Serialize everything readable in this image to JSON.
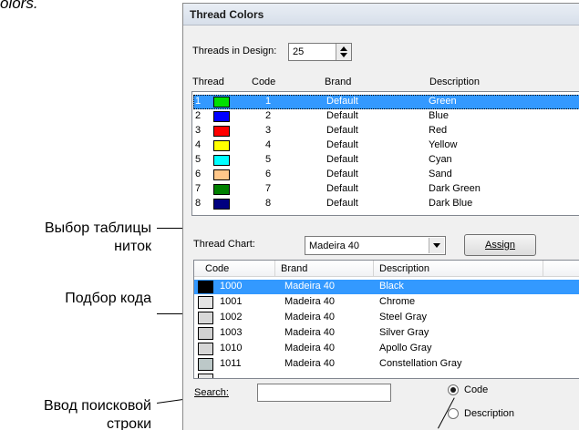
{
  "caption_fragment": "olors.",
  "annotations": {
    "thread_chart": [
      "Выбор таблицы",
      "ниток"
    ],
    "code_match": "Подбор кода",
    "search_entry": [
      "Ввод поисковой",
      "строки"
    ]
  },
  "dialog": {
    "title": "Thread Colors",
    "threads_in_design_label": "Threads in Design:",
    "threads_in_design_value": "25",
    "thread_list": {
      "headers": [
        "Thread",
        "Code",
        "Brand",
        "Description"
      ],
      "rows": [
        {
          "thread": "1",
          "color": "#00e000",
          "code": "1",
          "brand": "Default",
          "description": "Green",
          "selected": true
        },
        {
          "thread": "2",
          "color": "#0000ff",
          "code": "2",
          "brand": "Default",
          "description": "Blue"
        },
        {
          "thread": "3",
          "color": "#ff0000",
          "code": "3",
          "brand": "Default",
          "description": "Red"
        },
        {
          "thread": "4",
          "color": "#ffff00",
          "code": "4",
          "brand": "Default",
          "description": "Yellow"
        },
        {
          "thread": "5",
          "color": "#00ffff",
          "code": "5",
          "brand": "Default",
          "description": "Cyan"
        },
        {
          "thread": "6",
          "color": "#ffc78a",
          "code": "6",
          "brand": "Default",
          "description": "Sand"
        },
        {
          "thread": "7",
          "color": "#008000",
          "code": "7",
          "brand": "Default",
          "description": "Dark Green"
        },
        {
          "thread": "8",
          "color": "#000080",
          "code": "8",
          "brand": "Default",
          "description": "Dark Blue"
        }
      ]
    },
    "thread_chart_label": "Thread Chart:",
    "thread_chart_value": "Madeira 40",
    "assign_button": "Assign",
    "chart_list": {
      "headers": [
        "Code",
        "Brand",
        "Description"
      ],
      "rows": [
        {
          "code": "1000",
          "color": "#000000",
          "brand": "Madeira 40",
          "description": "Black",
          "selected": true
        },
        {
          "code": "1001",
          "color": "#e4e4e4",
          "brand": "Madeira 40",
          "description": "Chrome"
        },
        {
          "code": "1002",
          "color": "#d8d8d8",
          "brand": "Madeira 40",
          "description": "Steel Gray"
        },
        {
          "code": "1003",
          "color": "#d0d0d0",
          "brand": "Madeira 40",
          "description": "Silver Gray"
        },
        {
          "code": "1010",
          "color": "#d6d6d6",
          "brand": "Madeira 40",
          "description": "Apollo Gray"
        },
        {
          "code": "1011",
          "color": "#bcc8c8",
          "brand": "Madeira 40",
          "description": "Constellation Gray"
        }
      ]
    },
    "search_label": "Search:",
    "search_value": "",
    "radio_code": "Code",
    "radio_description": "Description",
    "radio_selected": "code"
  },
  "colors": {
    "selection": "#3399ff",
    "dialog_bg": "#f0f0f0"
  }
}
